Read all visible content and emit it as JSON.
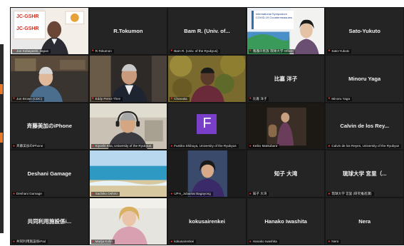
{
  "window": {
    "title": "Zoom gallery view"
  },
  "colors": {
    "mic_muted": "#e33333",
    "speaking_border": "#e9e86a",
    "tile_bg": "#242424"
  },
  "logos": {
    "brand": "JC-GSHR"
  },
  "slide": {
    "title": "International Symposium COVID-19 Countermeasures"
  },
  "tiles": [
    {
      "name_label": "Jun Kobayashi, Japan",
      "center_name": "",
      "kind": "video-slide"
    },
    {
      "name_label": "R.Tokumon",
      "center_name": "R.Tokumon",
      "kind": "name"
    },
    {
      "name_label": "Bam R. (Univ. of the Ryukyus)",
      "center_name": "Bam R. (Univ. of...",
      "kind": "name"
    },
    {
      "name_label": "看護の民族 琉球大学 Office",
      "center_name": "",
      "kind": "video-slide2"
    },
    {
      "name_label": "Sato-Yukuto",
      "center_name": "Sato-Yukuto",
      "kind": "name"
    },
    {
      "name_label": "Jun Brown (CDC)",
      "center_name": "",
      "kind": "video"
    },
    {
      "name_label": "Eddy Perez-Then",
      "center_name": "",
      "kind": "video"
    },
    {
      "name_label": "Chanaka",
      "center_name": "",
      "kind": "video"
    },
    {
      "name_label": "比嘉 洋子",
      "center_name": "比嘉 洋子",
      "kind": "name"
    },
    {
      "name_label": "Minoru Yaga",
      "center_name": "Minoru Yaga",
      "kind": "name"
    },
    {
      "name_label": "斉藤美加のiPhone",
      "center_name": "斉藤美加のiPhone",
      "kind": "name"
    },
    {
      "name_label": "Kiyoshi Kita, University of the Ryukyus",
      "center_name": "",
      "kind": "video-speaking"
    },
    {
      "name_label": "Fumiko Shibuya, University of the Ryukyus",
      "center_name": "",
      "kind": "avatar",
      "avatar_letter": "F"
    },
    {
      "name_label": "Keiko Matsubara",
      "center_name": "",
      "kind": "video"
    },
    {
      "name_label": "Calvin de los Reyes, University of the Ryukyus",
      "center_name": "Calvin de los Rey...",
      "kind": "name"
    },
    {
      "name_label": "Deshani Gamage",
      "center_name": "Deshani Gamage",
      "kind": "name"
    },
    {
      "name_label": "Sachiko Oshiro",
      "center_name": "",
      "kind": "video"
    },
    {
      "name_label": "UPH_Jubairiat Bagayong",
      "center_name": "",
      "kind": "video"
    },
    {
      "name_label": "知子 大湾",
      "center_name": "知子 大湾",
      "kind": "name"
    },
    {
      "name_label": "琉球大学 宮里 (研究推進課)",
      "center_name": "琉球大学 宮里（...",
      "kind": "name"
    },
    {
      "name_label": "共同利用施設係iPad",
      "center_name": "共同利用施設係i...",
      "kind": "name"
    },
    {
      "name_label": "Marija Kolin",
      "center_name": "",
      "kind": "video"
    },
    {
      "name_label": "kokusairenkei",
      "center_name": "kokusairenkei",
      "kind": "name"
    },
    {
      "name_label": "Hanako Iwashita",
      "center_name": "Hanako Iwashita",
      "kind": "name"
    },
    {
      "name_label": "Nera",
      "center_name": "Nera",
      "kind": "name"
    }
  ]
}
